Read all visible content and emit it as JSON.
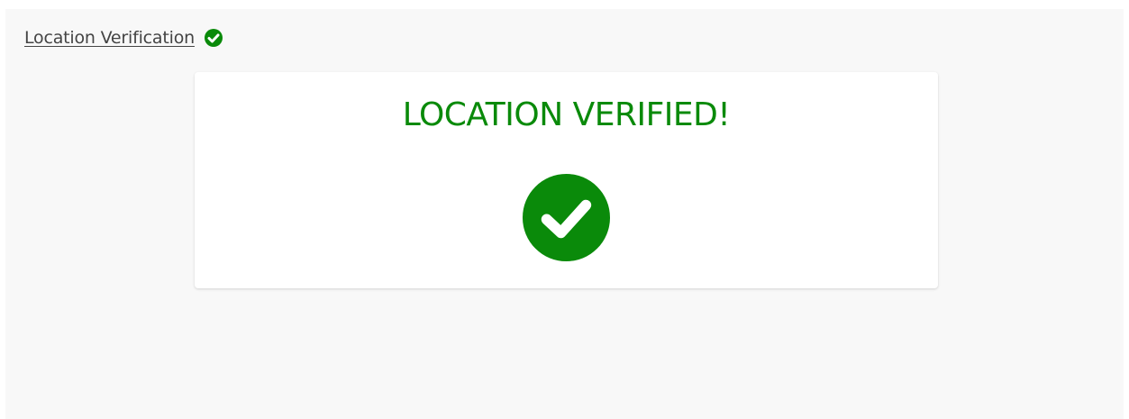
{
  "header": {
    "link_label": "Location Verification",
    "status_icon": "check-circle-icon"
  },
  "card": {
    "title": "LOCATION VERIFIED!",
    "icon": "check-circle-icon"
  },
  "colors": {
    "success_green": "#0a8a0a",
    "panel_bg": "#f8f8f8",
    "card_bg": "#ffffff",
    "link_text": "#444444"
  }
}
